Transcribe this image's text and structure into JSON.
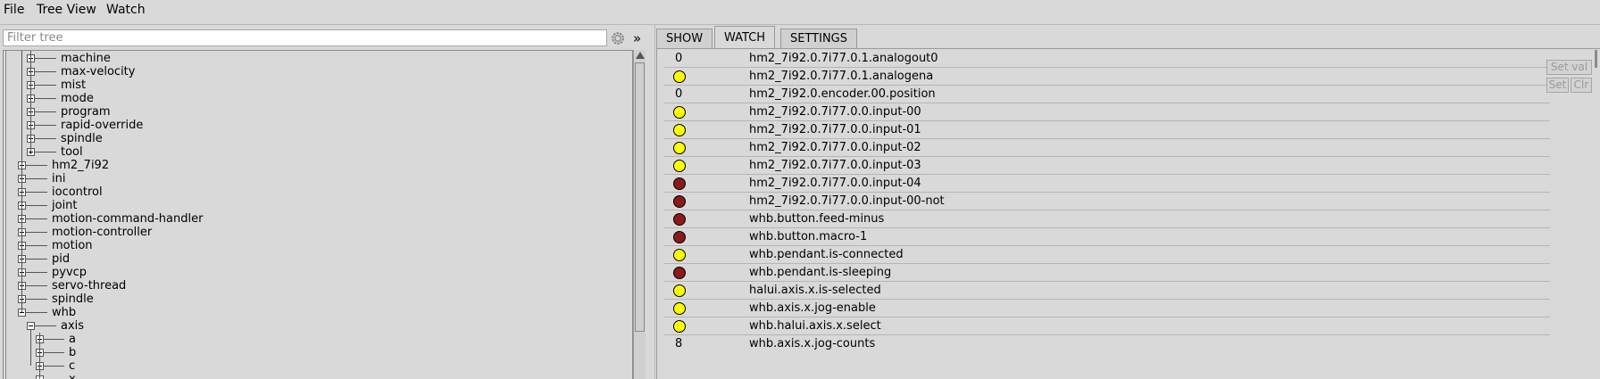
{
  "menu": [
    "File",
    "Tree View",
    "Watch"
  ],
  "filter": {
    "placeholder": "Filter tree",
    "value": ""
  },
  "icons": {
    "settings": "gear-icon",
    "more": "double-chevron-right-icon",
    "more_glyph": "»"
  },
  "tree": [
    {
      "label": "machine",
      "state": "collapsed",
      "level": 2
    },
    {
      "label": "max-velocity",
      "state": "collapsed",
      "level": 2
    },
    {
      "label": "mist",
      "state": "collapsed",
      "level": 2
    },
    {
      "label": "mode",
      "state": "collapsed",
      "level": 2
    },
    {
      "label": "program",
      "state": "collapsed",
      "level": 2
    },
    {
      "label": "rapid-override",
      "state": "collapsed",
      "level": 2
    },
    {
      "label": "spindle",
      "state": "collapsed",
      "level": 2
    },
    {
      "label": "tool",
      "state": "collapsed",
      "level": 2
    },
    {
      "label": "hm2_7i92",
      "state": "collapsed",
      "level": 1
    },
    {
      "label": "ini",
      "state": "collapsed",
      "level": 1
    },
    {
      "label": "iocontrol",
      "state": "collapsed",
      "level": 1
    },
    {
      "label": "joint",
      "state": "collapsed",
      "level": 1
    },
    {
      "label": "motion-command-handler",
      "state": "collapsed",
      "level": 1
    },
    {
      "label": "motion-controller",
      "state": "collapsed",
      "level": 1
    },
    {
      "label": "motion",
      "state": "collapsed",
      "level": 1
    },
    {
      "label": "pid",
      "state": "collapsed",
      "level": 1
    },
    {
      "label": "pyvcp",
      "state": "collapsed",
      "level": 1
    },
    {
      "label": "servo-thread",
      "state": "collapsed",
      "level": 1
    },
    {
      "label": "spindle",
      "state": "collapsed",
      "level": 1
    },
    {
      "label": "whb",
      "state": "expanded",
      "level": 1
    },
    {
      "label": "axis",
      "state": "expanded",
      "level": 2
    },
    {
      "label": "a",
      "state": "collapsed",
      "level": 3
    },
    {
      "label": "b",
      "state": "collapsed",
      "level": 3
    },
    {
      "label": "c",
      "state": "collapsed",
      "level": 3
    },
    {
      "label": "x",
      "state": "collapsed",
      "level": 3
    }
  ],
  "tabs": [
    {
      "label": "SHOW",
      "active": false
    },
    {
      "label": "WATCH",
      "active": true
    },
    {
      "label": "SETTINGS",
      "active": false
    }
  ],
  "colors": {
    "led_on": "#ffff00",
    "led_off": "#8b1a1a",
    "background": "#d9d9d9"
  },
  "watch": [
    {
      "kind": "value",
      "value": "0",
      "name": "hm2_7i92.0.7i77.0.1.analogout0"
    },
    {
      "kind": "led",
      "state": "on",
      "name": "hm2_7i92.0.7i77.0.1.analogena"
    },
    {
      "kind": "value",
      "value": "0",
      "name": "hm2_7i92.0.encoder.00.position"
    },
    {
      "kind": "led",
      "state": "on",
      "name": "hm2_7i92.0.7i77.0.0.input-00"
    },
    {
      "kind": "led",
      "state": "on",
      "name": "hm2_7i92.0.7i77.0.0.input-01"
    },
    {
      "kind": "led",
      "state": "on",
      "name": "hm2_7i92.0.7i77.0.0.input-02"
    },
    {
      "kind": "led",
      "state": "on",
      "name": "hm2_7i92.0.7i77.0.0.input-03"
    },
    {
      "kind": "led",
      "state": "off",
      "name": "hm2_7i92.0.7i77.0.0.input-04"
    },
    {
      "kind": "led",
      "state": "off",
      "name": "hm2_7i92.0.7i77.0.0.input-00-not"
    },
    {
      "kind": "led",
      "state": "off",
      "name": "whb.button.feed-minus"
    },
    {
      "kind": "led",
      "state": "off",
      "name": "whb.button.macro-1"
    },
    {
      "kind": "led",
      "state": "on",
      "name": "whb.pendant.is-connected"
    },
    {
      "kind": "led",
      "state": "off",
      "name": "whb.pendant.is-sleeping"
    },
    {
      "kind": "led",
      "state": "on",
      "name": "halui.axis.x.is-selected"
    },
    {
      "kind": "led",
      "state": "on",
      "name": "whb.axis.x.jog-enable"
    },
    {
      "kind": "led",
      "state": "on",
      "name": "whb.halui.axis.x.select"
    },
    {
      "kind": "value",
      "value": "8",
      "name": "whb.axis.x.jog-counts"
    }
  ],
  "side_buttons": {
    "set_value": "Set val",
    "set": "Set",
    "clear": "Clr"
  }
}
